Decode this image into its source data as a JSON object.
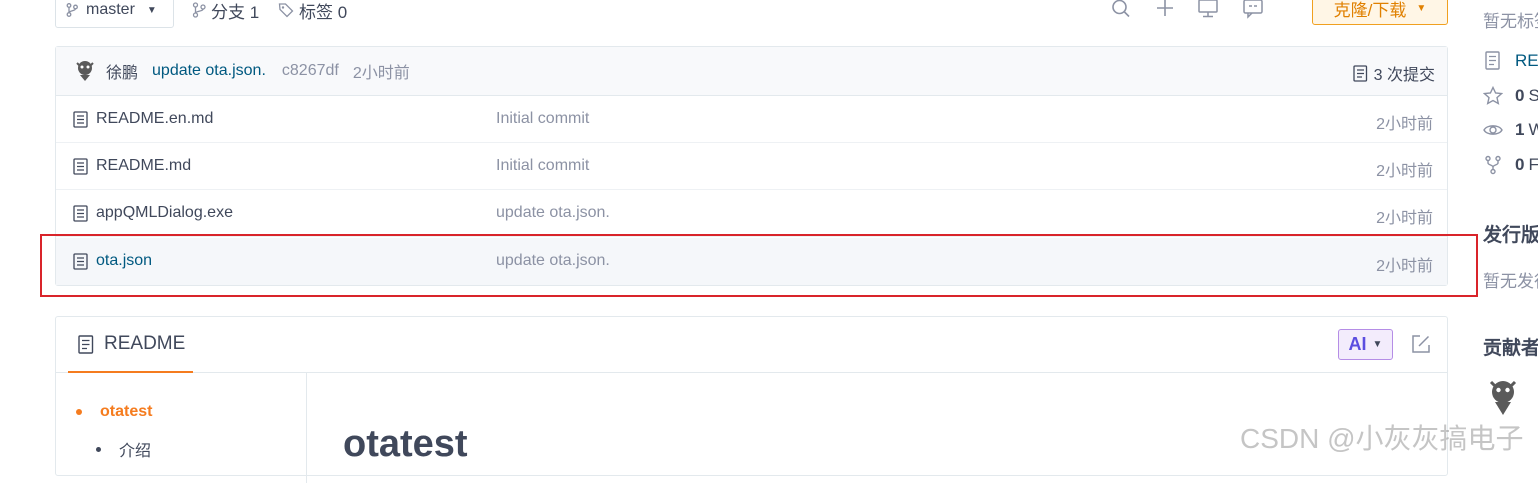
{
  "toolbar": {
    "branch": "master",
    "branches": "分支 1",
    "tags": "标签 0",
    "clone_button": "克隆/下载",
    "icons": [
      "search-icon",
      "plus-icon",
      "monitor-icon",
      "comment-icon"
    ]
  },
  "commit": {
    "author": "徐鹏",
    "message": "update ota.json.",
    "hash": "c8267df",
    "time": "2小时前",
    "count": "3 次提交"
  },
  "files": [
    {
      "name": "README.en.md",
      "commit": "Initial commit",
      "time": "2小时前"
    },
    {
      "name": "README.md",
      "commit": "Initial commit",
      "time": "2小时前"
    },
    {
      "name": "appQMLDialog.exe",
      "commit": "update ota.json.",
      "time": "2小时前"
    },
    {
      "name": "ota.json",
      "commit": "update ota.json.",
      "time": "2小时前"
    }
  ],
  "readme": {
    "tab_label": "README",
    "ai_label": "AI",
    "toc": [
      "otatest",
      "介绍"
    ],
    "heading": "otatest"
  },
  "sidebar": {
    "no_tags": "暂无标签",
    "readme_link": "README",
    "stars": {
      "count": "0",
      "label": "Stars"
    },
    "watches": {
      "count": "1",
      "label": "Watching"
    },
    "forks": {
      "count": "0",
      "label": "Forks"
    },
    "releases_heading": "发行版",
    "no_releases": "暂无发行版",
    "contributors_heading": "贡献者"
  },
  "watermark": "CSDN @小灰灰搞电子",
  "colors": {
    "accent": "#f57c1f",
    "link": "#005980",
    "highlight_box": "#d9242a"
  }
}
